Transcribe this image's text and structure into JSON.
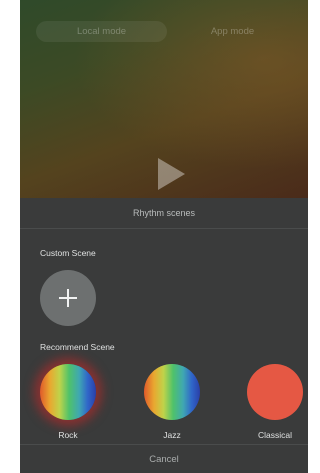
{
  "modes": {
    "local_label": "Local mode",
    "app_label": "App mode",
    "active": "local"
  },
  "player": {
    "play_icon": "play-icon"
  },
  "sheet": {
    "title": "Rhythm scenes",
    "custom_label": "Custom Scene",
    "add_icon": "plus-icon",
    "recommend_label": "Recommend Scene",
    "scenes": [
      {
        "label": "Rock",
        "selected": true
      },
      {
        "label": "Jazz",
        "selected": false
      },
      {
        "label": "Classical",
        "selected": false
      }
    ],
    "cancel_label": "Cancel"
  }
}
